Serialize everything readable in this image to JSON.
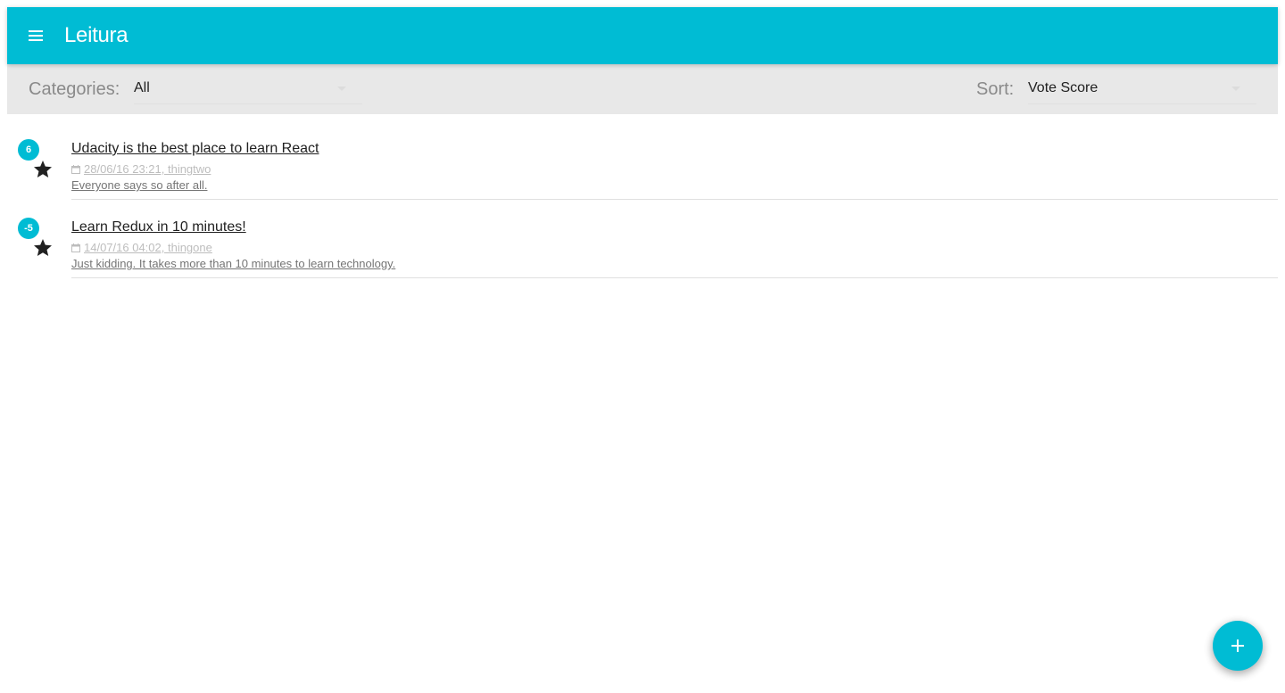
{
  "appbar": {
    "title": "Leitura",
    "menu_icon": "hamburger-menu-icon",
    "color": "#00bcd4"
  },
  "toolbar": {
    "categories_label": "Categories:",
    "categories_value": "All",
    "sort_label": "Sort:",
    "sort_value": "Vote Score",
    "background": "#e8e8e8"
  },
  "posts": [
    {
      "vote_score": "6",
      "title": "Udacity is the best place to learn React",
      "meta": "28/06/16 23:21, thingtwo",
      "body": "Everyone says so after all.",
      "icon": "star-icon"
    },
    {
      "vote_score": "-5",
      "title": "Learn Redux in 10 minutes!",
      "meta": "14/07/16 04:02, thingone",
      "body": "Just kidding. It takes more than 10 minutes to learn technology.",
      "icon": "star-icon"
    }
  ],
  "fab": {
    "icon": "plus-icon"
  }
}
